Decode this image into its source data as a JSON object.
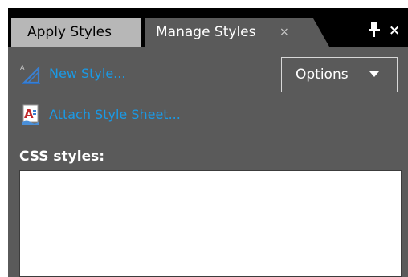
{
  "tabs": [
    {
      "label": "Apply Styles",
      "active": false
    },
    {
      "label": "Manage Styles",
      "active": true,
      "close_glyph": "×"
    }
  ],
  "window_controls": {
    "pin_icon": "pushpin-icon",
    "close_glyph": "×"
  },
  "actions": {
    "new_style": {
      "label": "New Style...",
      "icon": "new-style-icon"
    },
    "attach_style_sheet": {
      "label": "Attach Style Sheet...",
      "icon": "attach-stylesheet-icon"
    }
  },
  "options_button": {
    "label": "Options"
  },
  "css_styles": {
    "label": "CSS styles:",
    "items": []
  },
  "colors": {
    "panel_bg": "#5a5a5a",
    "tabbar_bg": "#000000",
    "inactive_tab_bg": "#b7b7b7",
    "link": "#1a9ae6",
    "list_bg": "#ffffff"
  }
}
